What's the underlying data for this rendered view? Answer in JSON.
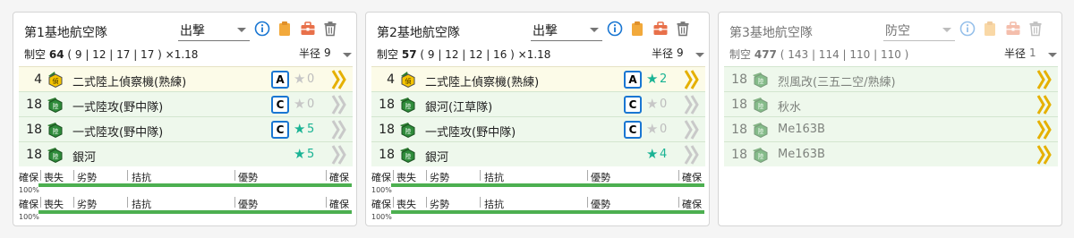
{
  "colors": {
    "accent": "#1976d2",
    "star_on": "#1ab394",
    "proficiency": "#e5b000",
    "bar_fill": "#4caf50",
    "recon_row_bg": "#fcfbe8",
    "attack_row_bg": "#eef8ec"
  },
  "header_icons": [
    "info-icon",
    "clipboard-icon",
    "toolbox-icon",
    "trash-icon"
  ],
  "corps": [
    {
      "title": "第1基地航空隊",
      "mode": "出撃",
      "air_label": "制空",
      "air_value": "64",
      "air_detail": "( 9 | 12 | 17 | 17 ) ×1.18",
      "range_label": "半径",
      "range_value": "9",
      "planes": [
        {
          "count": "4",
          "name": "二式陸上偵察機(熟練)",
          "grade": "A",
          "star": "★",
          "level": "0",
          "star_state": "off",
          "type": "recon"
        },
        {
          "count": "18",
          "name": "一式陸攻(野中隊)",
          "grade": "C",
          "star": "★",
          "level": "0",
          "star_state": "off",
          "type": "attack"
        },
        {
          "count": "18",
          "name": "一式陸攻(野中隊)",
          "grade": "C",
          "star": "★",
          "level": "5",
          "star_state": "on",
          "type": "attack"
        },
        {
          "count": "18",
          "name": "銀河",
          "grade": "",
          "star": "★",
          "level": "5",
          "star_state": "on",
          "type": "attack"
        }
      ],
      "status_bars": [
        {
          "labels": [
            "確保",
            "喪失",
            "劣勢",
            "拮抗",
            "優勢",
            "確保"
          ],
          "percent": "100%"
        },
        {
          "labels": [
            "確保",
            "喪失",
            "劣勢",
            "拮抗",
            "優勢",
            "確保"
          ],
          "percent": "100%"
        }
      ]
    },
    {
      "title": "第2基地航空隊",
      "mode": "出撃",
      "air_label": "制空",
      "air_value": "57",
      "air_detail": "( 9 | 12 | 12 | 16 ) ×1.18",
      "range_label": "半径",
      "range_value": "9",
      "planes": [
        {
          "count": "4",
          "name": "二式陸上偵察機(熟練)",
          "grade": "A",
          "star": "★",
          "level": "2",
          "star_state": "on",
          "type": "recon"
        },
        {
          "count": "18",
          "name": "銀河(江草隊)",
          "grade": "C",
          "star": "★",
          "level": "0",
          "star_state": "off",
          "type": "attack"
        },
        {
          "count": "18",
          "name": "一式陸攻(野中隊)",
          "grade": "C",
          "star": "★",
          "level": "0",
          "star_state": "off",
          "type": "attack"
        },
        {
          "count": "18",
          "name": "銀河",
          "grade": "",
          "star": "★",
          "level": "4",
          "star_state": "on",
          "type": "attack"
        }
      ],
      "status_bars": [
        {
          "labels": [
            "確保",
            "喪失",
            "劣勢",
            "拮抗",
            "優勢",
            "確保"
          ],
          "percent": "100%"
        },
        {
          "labels": [
            "確保",
            "喪失",
            "劣勢",
            "拮抗",
            "優勢",
            "確保"
          ],
          "percent": "100%"
        }
      ]
    },
    {
      "title": "第3基地航空隊",
      "mode": "防空",
      "air_label": "制空",
      "air_value": "477",
      "air_detail": "( 143 | 114 | 110 | 110 )",
      "range_label": "半径",
      "range_value": "1",
      "planes": [
        {
          "count": "18",
          "name": "烈風改(三五二空/熟練)",
          "grade": "",
          "star": "",
          "level": "",
          "star_state": "off",
          "type": "fighter"
        },
        {
          "count": "18",
          "name": "秋水",
          "grade": "",
          "star": "",
          "level": "",
          "star_state": "off",
          "type": "fighter"
        },
        {
          "count": "18",
          "name": "Me163B",
          "grade": "",
          "star": "",
          "level": "",
          "star_state": "off",
          "type": "fighter"
        },
        {
          "count": "18",
          "name": "Me163B",
          "grade": "",
          "star": "",
          "level": "",
          "star_state": "off",
          "type": "fighter"
        }
      ],
      "status_bars": []
    }
  ]
}
